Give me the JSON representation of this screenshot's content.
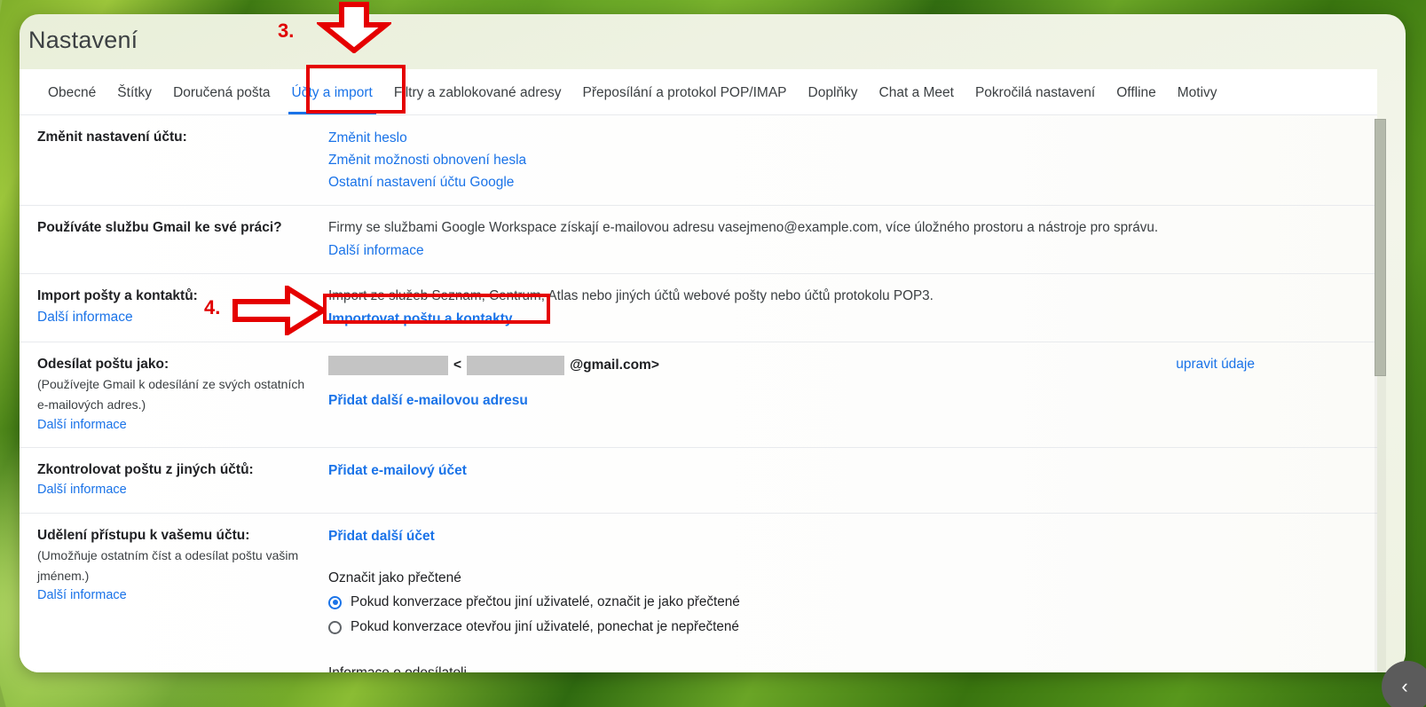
{
  "window": {
    "title": "Nastavení"
  },
  "tabs": [
    {
      "label": "Obecné",
      "active": false
    },
    {
      "label": "Štítky",
      "active": false
    },
    {
      "label": "Doručená pošta",
      "active": false
    },
    {
      "label": "Účty a import",
      "active": true
    },
    {
      "label": "Filtry a zablokované adresy",
      "active": false
    },
    {
      "label": "Přeposílání a protokol POP/IMAP",
      "active": false
    },
    {
      "label": "Doplňky",
      "active": false
    },
    {
      "label": "Chat a Meet",
      "active": false
    },
    {
      "label": "Pokročilá nastavení",
      "active": false
    },
    {
      "label": "Offline",
      "active": false
    },
    {
      "label": "Motivy",
      "active": false
    }
  ],
  "sections": {
    "change_account": {
      "label": "Změnit nastavení účtu:",
      "links": [
        "Změnit heslo",
        "Změnit možnosti obnovení hesla",
        "Ostatní nastavení účtu Google"
      ]
    },
    "gmail_for_work": {
      "label": "Používáte službu Gmail ke své práci?",
      "text": "Firmy se službami Google Workspace získají e-mailovou adresu vasejmeno@example.com, více úložného prostoru a nástroje pro správu.",
      "more_info": "Další informace"
    },
    "import": {
      "label": "Import pošty a kontaktů:",
      "more_info": "Další informace",
      "text": "Import ze služeb Seznam, Centrum, Atlas nebo jiných účtů webové pošty nebo účtů protokolu POP3.",
      "action": "Importovat poštu a kontakty"
    },
    "send_mail_as": {
      "label": "Odesílat poštu jako:",
      "note_line1": "(Používejte Gmail k odesílání ze svých ostatních",
      "note_line2": "e-mailových adres.)",
      "more_info": "Další informace",
      "redacted_name": "",
      "redacted_user": "",
      "bracket_open": "<",
      "domain_suffix": "@gmail.com>",
      "edit_info": "upravit údaje",
      "add_address": "Přidat další e-mailovou adresu"
    },
    "check_mail": {
      "label": "Zkontrolovat poštu z jiných účtů:",
      "more_info": "Další informace",
      "action": "Přidat e-mailový účet"
    },
    "grant_access": {
      "label": "Udělení přístupu k vašemu účtu:",
      "note_line1": "(Umožňuje ostatním číst a odesílat poštu vašim",
      "note_line2": "jménem.)",
      "more_info": "Další informace",
      "action": "Přidat další účet",
      "mark_read_title": "Označit jako přečtené",
      "radio_options": [
        {
          "label": "Pokud konverzace přečtou jiní uživatelé, označit je jako přečtené",
          "selected": true
        },
        {
          "label": "Pokud konverzace otevřou jiní uživatelé, ponechat je nepřečtené",
          "selected": false
        }
      ],
      "sender_info_title": "Informace o odesílateli"
    }
  },
  "controls": {
    "collapse_chevron": "‹"
  },
  "annotations": [
    {
      "number": "3."
    },
    {
      "number": "4."
    }
  ],
  "colors": {
    "accent_blue": "#1a73e8",
    "annotation_red": "#e50000",
    "text_primary": "#202124",
    "redaction_gray": "#c4c4c4"
  }
}
